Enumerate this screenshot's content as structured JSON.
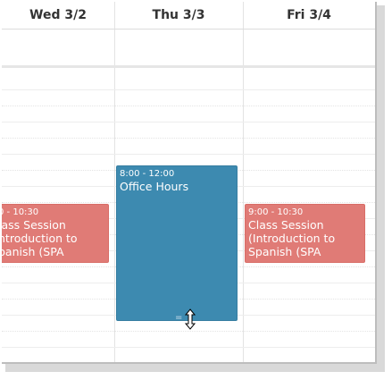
{
  "calendar": {
    "days": [
      {
        "label": "Wed 3/2"
      },
      {
        "label": "Thu 3/3"
      },
      {
        "label": "Fri 3/4"
      }
    ],
    "events": [
      {
        "time": "0 - 10:30",
        "title": "lass Session\nntroduction to\npanish (SPA",
        "color": "#e07b76"
      },
      {
        "time": "8:00 - 12:00",
        "title": "Office Hours",
        "color": "#3d8ab0"
      },
      {
        "time": "9:00 - 10:30",
        "title": "Class Session\n(Introduction to\nSpanish (SPA",
        "color": "#e07b76"
      }
    ],
    "cursor": {
      "icon": "resize-vertical-cursor-icon"
    },
    "grip": {
      "icon": "resize-grip-icon",
      "glyph": "="
    }
  }
}
